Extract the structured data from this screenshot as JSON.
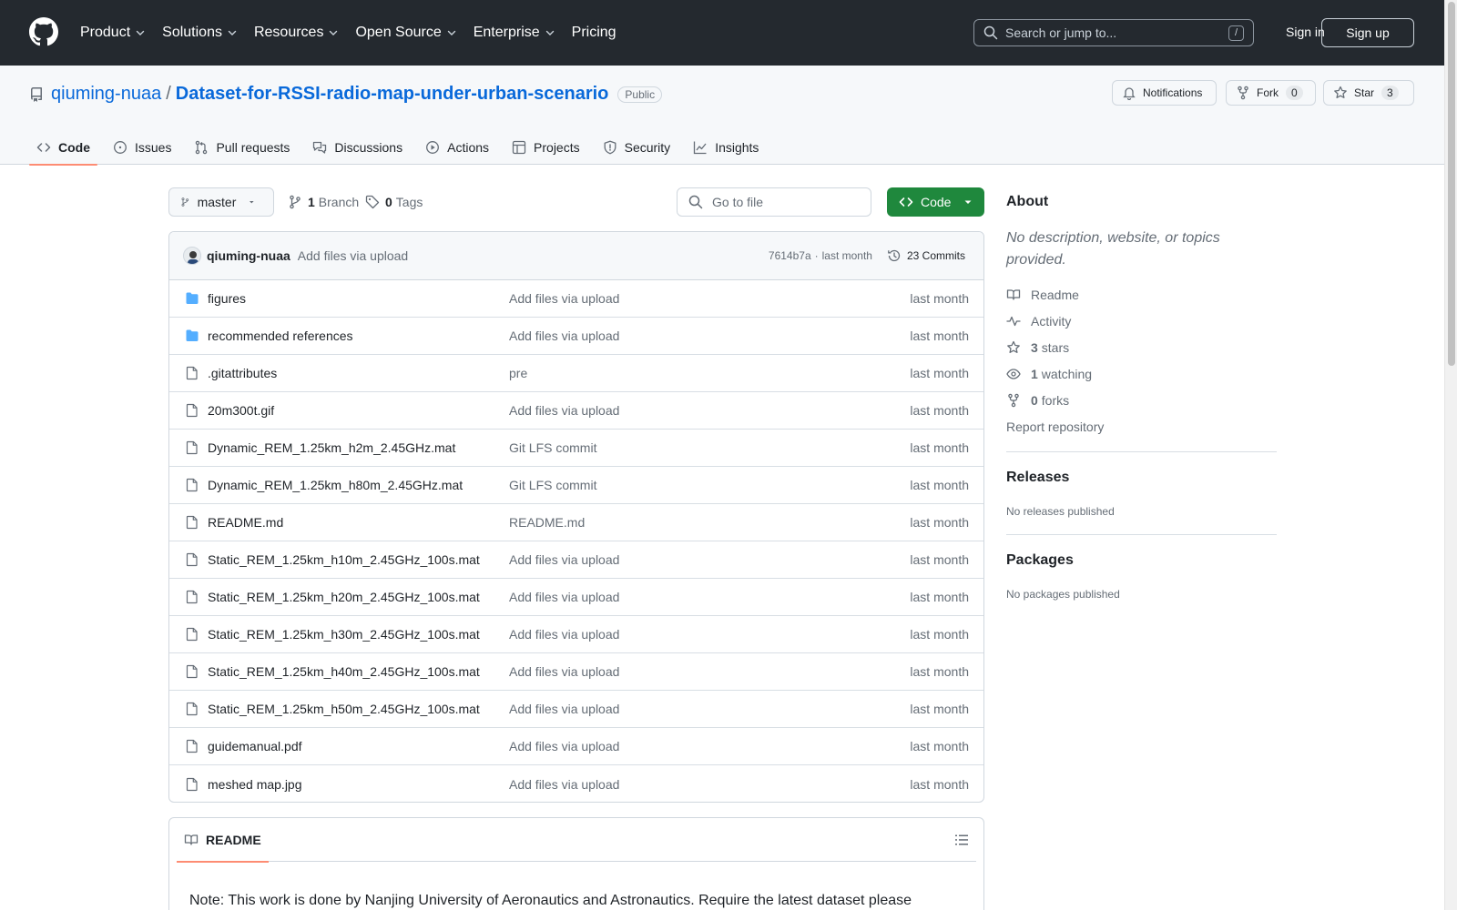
{
  "header": {
    "nav": [
      {
        "label": "Product",
        "dropdown": true
      },
      {
        "label": "Solutions",
        "dropdown": true
      },
      {
        "label": "Resources",
        "dropdown": true
      },
      {
        "label": "Open Source",
        "dropdown": true
      },
      {
        "label": "Enterprise",
        "dropdown": true
      },
      {
        "label": "Pricing",
        "dropdown": false
      }
    ],
    "search_placeholder": "Search or jump to...",
    "search_shortcut": "/",
    "signin": "Sign in",
    "signup": "Sign up"
  },
  "repo": {
    "owner": "qiuming-nuaa",
    "separator": "/",
    "name": "Dataset-for-RSSI-radio-map-under-urban-scenario",
    "visibility": "Public",
    "notifications_label": "Notifications",
    "fork_label": "Fork",
    "fork_count": "0",
    "star_label": "Star",
    "star_count": "3",
    "tabs": [
      {
        "label": "Code",
        "icon": "code-icon",
        "active": true
      },
      {
        "label": "Issues",
        "icon": "issue-icon"
      },
      {
        "label": "Pull requests",
        "icon": "pull-request-icon"
      },
      {
        "label": "Discussions",
        "icon": "discussions-icon"
      },
      {
        "label": "Actions",
        "icon": "play-icon"
      },
      {
        "label": "Projects",
        "icon": "table-icon"
      },
      {
        "label": "Security",
        "icon": "shield-icon"
      },
      {
        "label": "Insights",
        "icon": "graph-icon"
      }
    ]
  },
  "toolbar": {
    "branch": "master",
    "branch_count": "1",
    "branch_label": "Branch",
    "tag_count": "0",
    "tag_label": "Tags",
    "goto_placeholder": "Go to file",
    "code_label": "Code"
  },
  "commit": {
    "author": "qiuming-nuaa",
    "message": "Add files via upload",
    "hash": "7614b7a",
    "dot": "·",
    "time": "last month",
    "commits_label": "23 Commits"
  },
  "files": [
    {
      "name": "figures",
      "type": "dir",
      "message": "Add files via upload",
      "date": "last month"
    },
    {
      "name": "recommended references",
      "type": "dir",
      "message": "Add files via upload",
      "date": "last month"
    },
    {
      "name": ".gitattributes",
      "type": "file",
      "message": "pre",
      "date": "last month"
    },
    {
      "name": "20m300t.gif",
      "type": "file",
      "message": "Add files via upload",
      "date": "last month"
    },
    {
      "name": "Dynamic_REM_1.25km_h2m_2.45GHz.mat",
      "type": "file",
      "message": "Git LFS commit",
      "date": "last month"
    },
    {
      "name": "Dynamic_REM_1.25km_h80m_2.45GHz.mat",
      "type": "file",
      "message": "Git LFS commit",
      "date": "last month"
    },
    {
      "name": "README.md",
      "type": "file",
      "message": "README.md",
      "date": "last month"
    },
    {
      "name": "Static_REM_1.25km_h10m_2.45GHz_100s.mat",
      "type": "file",
      "message": "Add files via upload",
      "date": "last month"
    },
    {
      "name": "Static_REM_1.25km_h20m_2.45GHz_100s.mat",
      "type": "file",
      "message": "Add files via upload",
      "date": "last month"
    },
    {
      "name": "Static_REM_1.25km_h30m_2.45GHz_100s.mat",
      "type": "file",
      "message": "Add files via upload",
      "date": "last month"
    },
    {
      "name": "Static_REM_1.25km_h40m_2.45GHz_100s.mat",
      "type": "file",
      "message": "Add files via upload",
      "date": "last month"
    },
    {
      "name": "Static_REM_1.25km_h50m_2.45GHz_100s.mat",
      "type": "file",
      "message": "Add files via upload",
      "date": "last month"
    },
    {
      "name": "guidemanual.pdf",
      "type": "file",
      "message": "Add files via upload",
      "date": "last month"
    },
    {
      "name": "meshed map.jpg",
      "type": "file",
      "message": "Add files via upload",
      "date": "last month"
    }
  ],
  "readme": {
    "tab_label": "README",
    "body": "Note: This work is done by Nanjing University of Aeronautics and Astronautics. Require the latest dataset please"
  },
  "sidebar": {
    "about_title": "About",
    "about_desc": "No description, website, or topics provided.",
    "readme_link": "Readme",
    "activity_link": "Activity",
    "stars_count": "3",
    "stars_label": "stars",
    "watching_count": "1",
    "watching_label": "watching",
    "forks_count": "0",
    "forks_label": "forks",
    "report": "Report repository",
    "releases_title": "Releases",
    "releases_none": "No releases published",
    "packages_title": "Packages",
    "packages_none": "No packages published"
  },
  "colors": {
    "header_bg": "#24292f",
    "link": "#0969da",
    "code_button": "#1f883d",
    "tab_underline": "#fd8c73",
    "folder": "#54aeff"
  }
}
